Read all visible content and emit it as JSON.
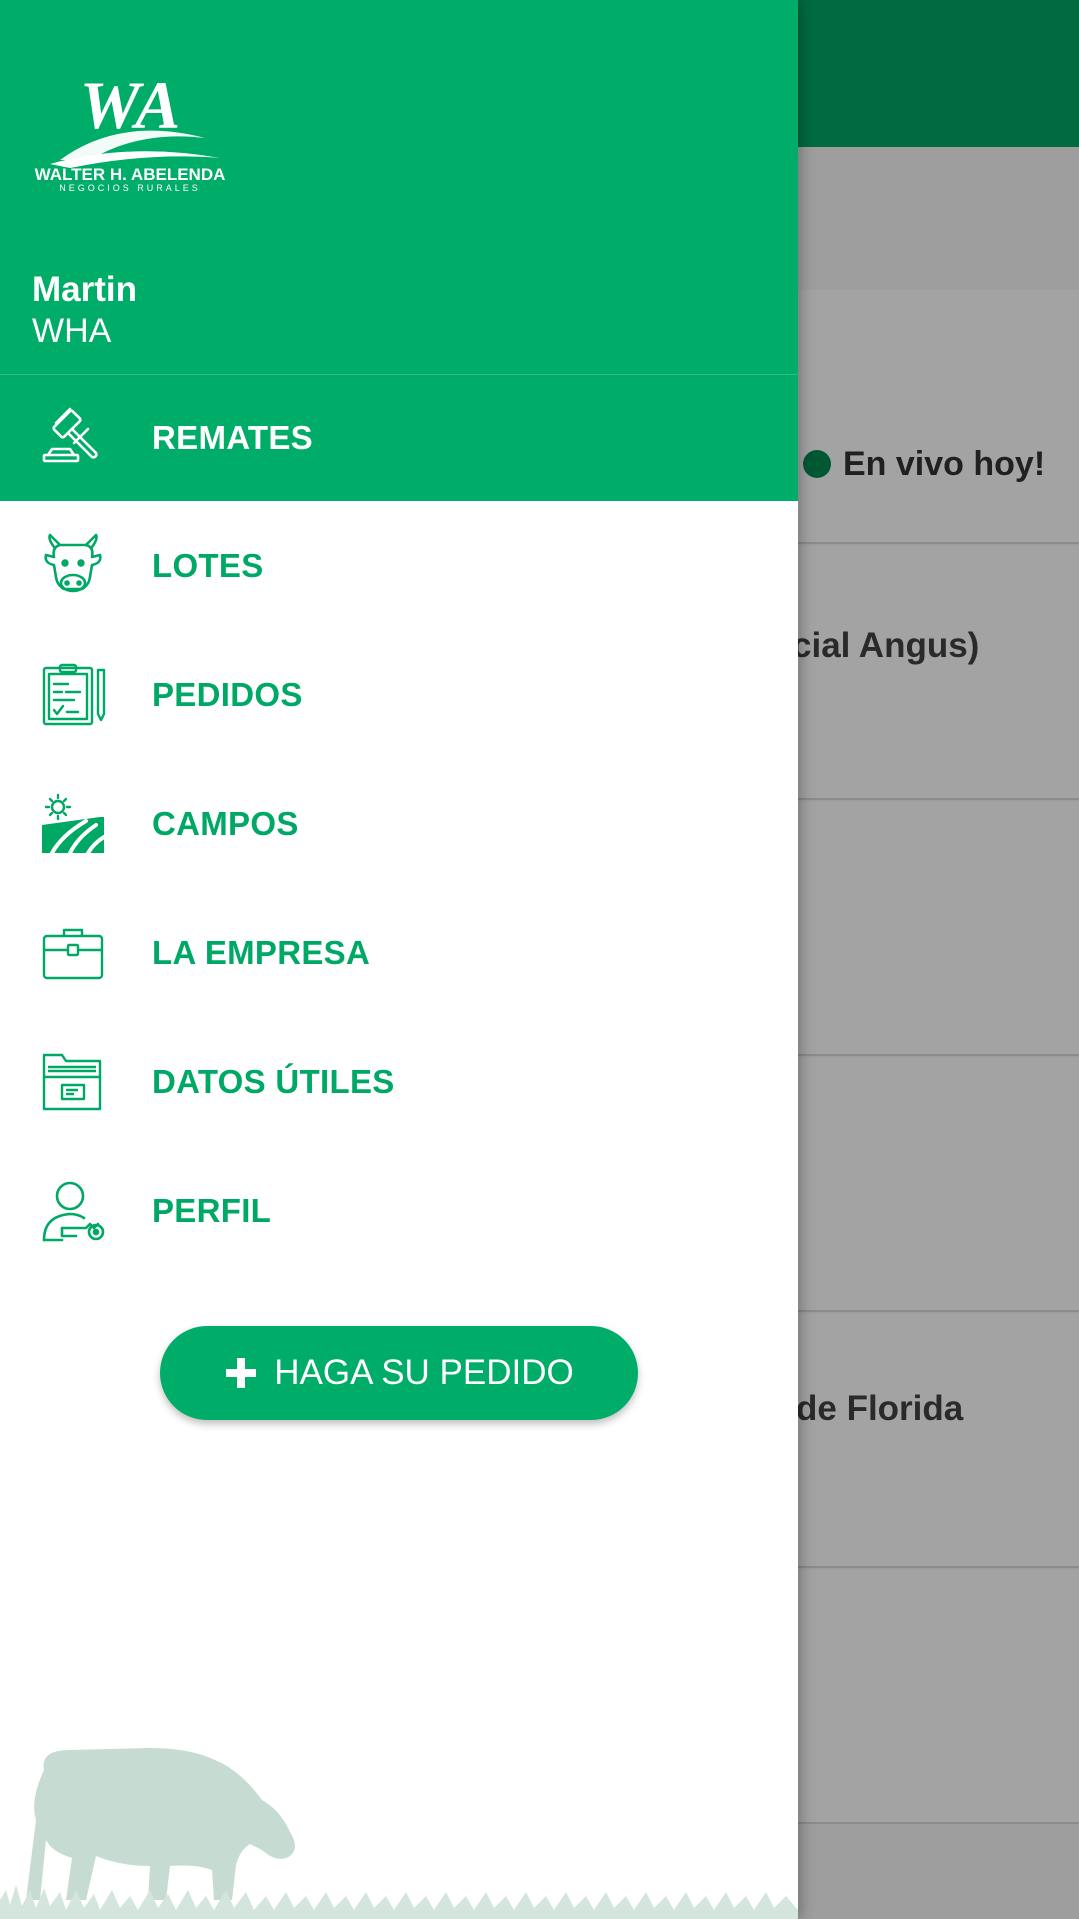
{
  "background": {
    "live_badge": "En vivo hoy!",
    "rows": [
      {
        "text": ""
      },
      {
        "text": "cial Angus)"
      },
      {
        "text": ""
      },
      {
        "text": ""
      },
      {
        "text": "de Florida"
      },
      {
        "text": ""
      }
    ]
  },
  "drawer": {
    "brand": {
      "logo_mark": "WA",
      "logo_name": "WALTER H. ABELENDA",
      "logo_tagline": "NEGOCIOS RURALES"
    },
    "user": {
      "name": "Martin",
      "org": "WHA"
    },
    "menu": [
      {
        "label": "REMATES",
        "icon": "gavel-icon",
        "active": true
      },
      {
        "label": "LOTES",
        "icon": "cow-face-icon",
        "active": false
      },
      {
        "label": "PEDIDOS",
        "icon": "clipboard-icon",
        "active": false
      },
      {
        "label": "CAMPOS",
        "icon": "field-sun-icon",
        "active": false
      },
      {
        "label": "LA EMPRESA",
        "icon": "briefcase-icon",
        "active": false
      },
      {
        "label": "DATOS ÚTILES",
        "icon": "folder-icon",
        "active": false
      },
      {
        "label": "PERFIL",
        "icon": "user-key-icon",
        "active": false
      }
    ],
    "order_button": {
      "label": "HAGA SU PEDIDO",
      "icon": "plus-icon"
    }
  },
  "colors": {
    "brand_green": "#00ad68",
    "dark_green": "#007a48",
    "text_green": "#00a865",
    "scrim": "rgba(0,0,0,0.36)"
  }
}
